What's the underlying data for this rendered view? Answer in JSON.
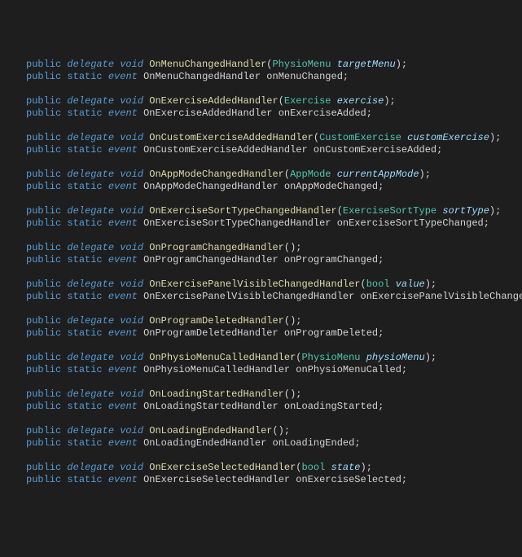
{
  "kw": {
    "public": "public",
    "static": "static",
    "delegate": "delegate",
    "void": "void",
    "event": "event"
  },
  "blocks": [
    {
      "delegateName": "OnMenuChangedHandler",
      "paramType": "PhysioMenu",
      "paramName": "targetMenu",
      "eventName": "onMenuChanged"
    },
    {
      "delegateName": "OnExerciseAddedHandler",
      "paramType": "Exercise",
      "paramName": "exercise",
      "eventName": "onExerciseAdded"
    },
    {
      "delegateName": "OnCustomExerciseAddedHandler",
      "paramType": "CustomExercise",
      "paramName": "customExercise",
      "eventName": "onCustomExerciseAdded"
    },
    {
      "delegateName": "OnAppModeChangedHandler",
      "paramType": "AppMode",
      "paramName": "currentAppMode",
      "eventName": "onAppModeChanged"
    },
    {
      "delegateName": "OnExerciseSortTypeChangedHandler",
      "paramType": "ExerciseSortType",
      "paramName": "sortType",
      "eventName": "onExerciseSortTypeChanged"
    },
    {
      "delegateName": "OnProgramChangedHandler",
      "paramType": null,
      "paramName": null,
      "eventName": "onProgramChanged"
    },
    {
      "delegateName": "OnExercisePanelVisibleChangedHandler",
      "paramType": "bool",
      "paramName": "value",
      "eventName": "onExercisePanelVisibleChanged"
    },
    {
      "delegateName": "OnProgramDeletedHandler",
      "paramType": null,
      "paramName": null,
      "eventName": "onProgramDeleted"
    },
    {
      "delegateName": "OnPhysioMenuCalledHandler",
      "paramType": "PhysioMenu",
      "paramName": "physioMenu",
      "eventName": "onPhysioMenuCalled"
    },
    {
      "delegateName": "OnLoadingStartedHandler",
      "paramType": null,
      "paramName": null,
      "eventName": "onLoadingStarted"
    },
    {
      "delegateName": "OnLoadingEndedHandler",
      "paramType": null,
      "paramName": null,
      "eventName": "onLoadingEnded"
    },
    {
      "delegateName": "OnExerciseSelectedHandler",
      "paramType": "bool",
      "paramName": "state",
      "eventName": "onExerciseSelected"
    }
  ]
}
